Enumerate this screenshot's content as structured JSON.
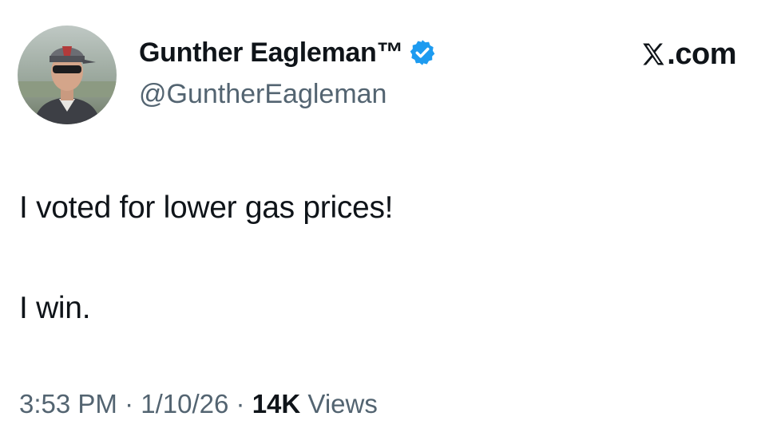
{
  "author": {
    "display_name": "Gunther Eagleman™",
    "handle": "@GuntherEagleman",
    "verified": true,
    "verified_color": "#1d9bf0"
  },
  "brand": {
    "icon": "x-logo-icon",
    "domain": ".com"
  },
  "tweet": {
    "lines": [
      "I voted for lower gas prices!",
      "I win."
    ]
  },
  "meta": {
    "time": "3:53 PM",
    "separator": "·",
    "date": "1/10/26",
    "views_count": "14K",
    "views_label": "Views"
  },
  "colors": {
    "text": "#0f1419",
    "secondary": "#536471",
    "accent": "#1d9bf0"
  }
}
